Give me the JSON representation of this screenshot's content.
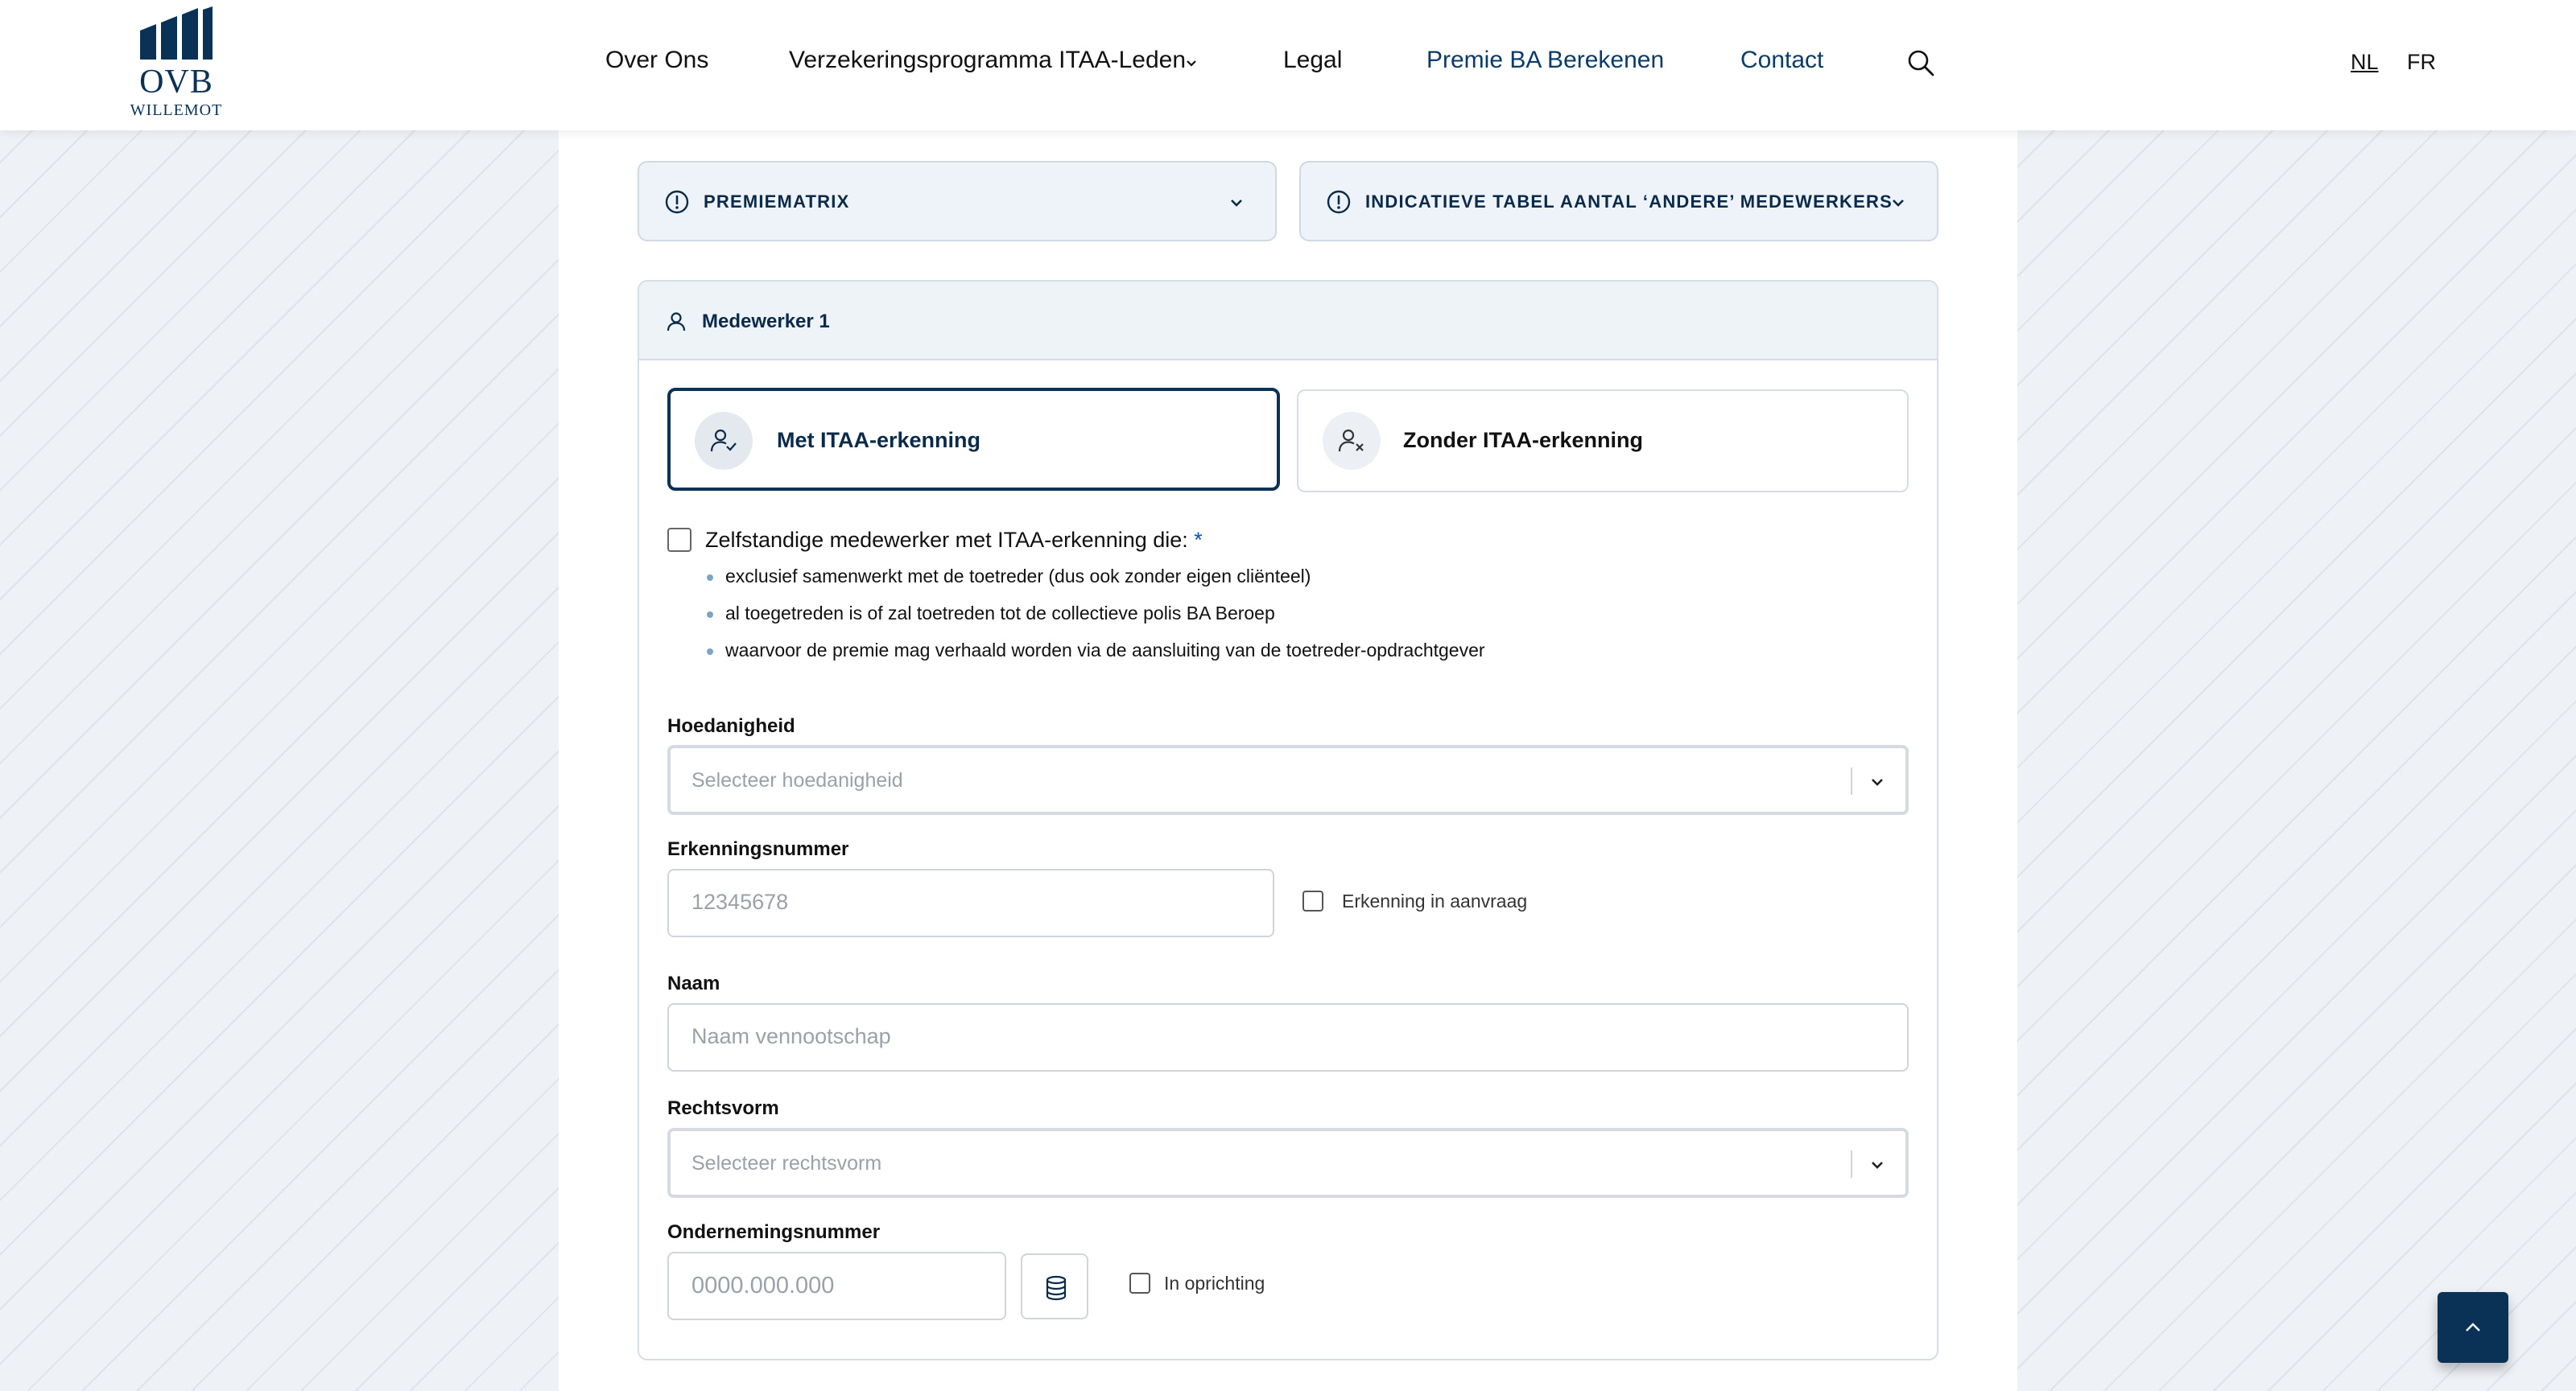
{
  "brand": {
    "name": "OVB",
    "sub": "WILLEMOT"
  },
  "nav": {
    "items": [
      {
        "label": "Over Ons"
      },
      {
        "label": "Verzekeringsprogramma ITAA-Leden"
      },
      {
        "label": "Legal"
      },
      {
        "label": "Premie BA Berekenen"
      },
      {
        "label": "Contact"
      }
    ],
    "active_item": "Premie BA Berekenen",
    "languages": [
      "NL",
      "FR"
    ],
    "current_language": "NL"
  },
  "accordions": [
    {
      "label": "PREMIEMATRIX"
    },
    {
      "label": "INDICATIEVE TABEL AANTAL ‘ANDERE’ MEDEWERKERS"
    }
  ],
  "card": {
    "title": "Medewerker 1",
    "options": [
      {
        "label": "Met ITAA-erkenning",
        "selected": true
      },
      {
        "label": "Zonder ITAA-erkenning",
        "selected": false
      }
    ],
    "declaration": {
      "label": "Zelfstandige medewerker met ITAA-erkenning die:",
      "required_mark": "*",
      "bullets": [
        "exclusief samenwerkt met de toetreder (dus ook zonder eigen cliënteel)",
        "al toegetreden is of zal toetreden tot de collectieve polis BA Beroep",
        "waarvoor de premie mag verhaald worden via de aansluiting van de toetreder-opdrachtgever"
      ]
    },
    "fields": {
      "hoedanigheid": {
        "label": "Hoedanigheid",
        "placeholder": "Selecteer hoedanigheid"
      },
      "erkenningsnummer": {
        "label": "Erkenningsnummer",
        "placeholder": "12345678",
        "checkbox_label": "Erkenning in aanvraag"
      },
      "naam": {
        "label": "Naam",
        "placeholder": "Naam vennootschap"
      },
      "rechtsvorm": {
        "label": "Rechtsvorm",
        "placeholder": "Selecteer rechtsvorm"
      },
      "ondernemingsnummer": {
        "label": "Ondernemingsnummer",
        "placeholder": "0000.000.000",
        "checkbox_label": "In oprichting"
      }
    }
  },
  "colors": {
    "brand_navy": "#0a3257",
    "accent_blue": "#0a4fb3",
    "panel_bg": "#eef3fa"
  },
  "icons": [
    "search-icon",
    "info-icon",
    "chevron-down-icon",
    "user-icon",
    "user-check-icon",
    "user-x-icon",
    "database-icon",
    "chevron-up-icon"
  ]
}
